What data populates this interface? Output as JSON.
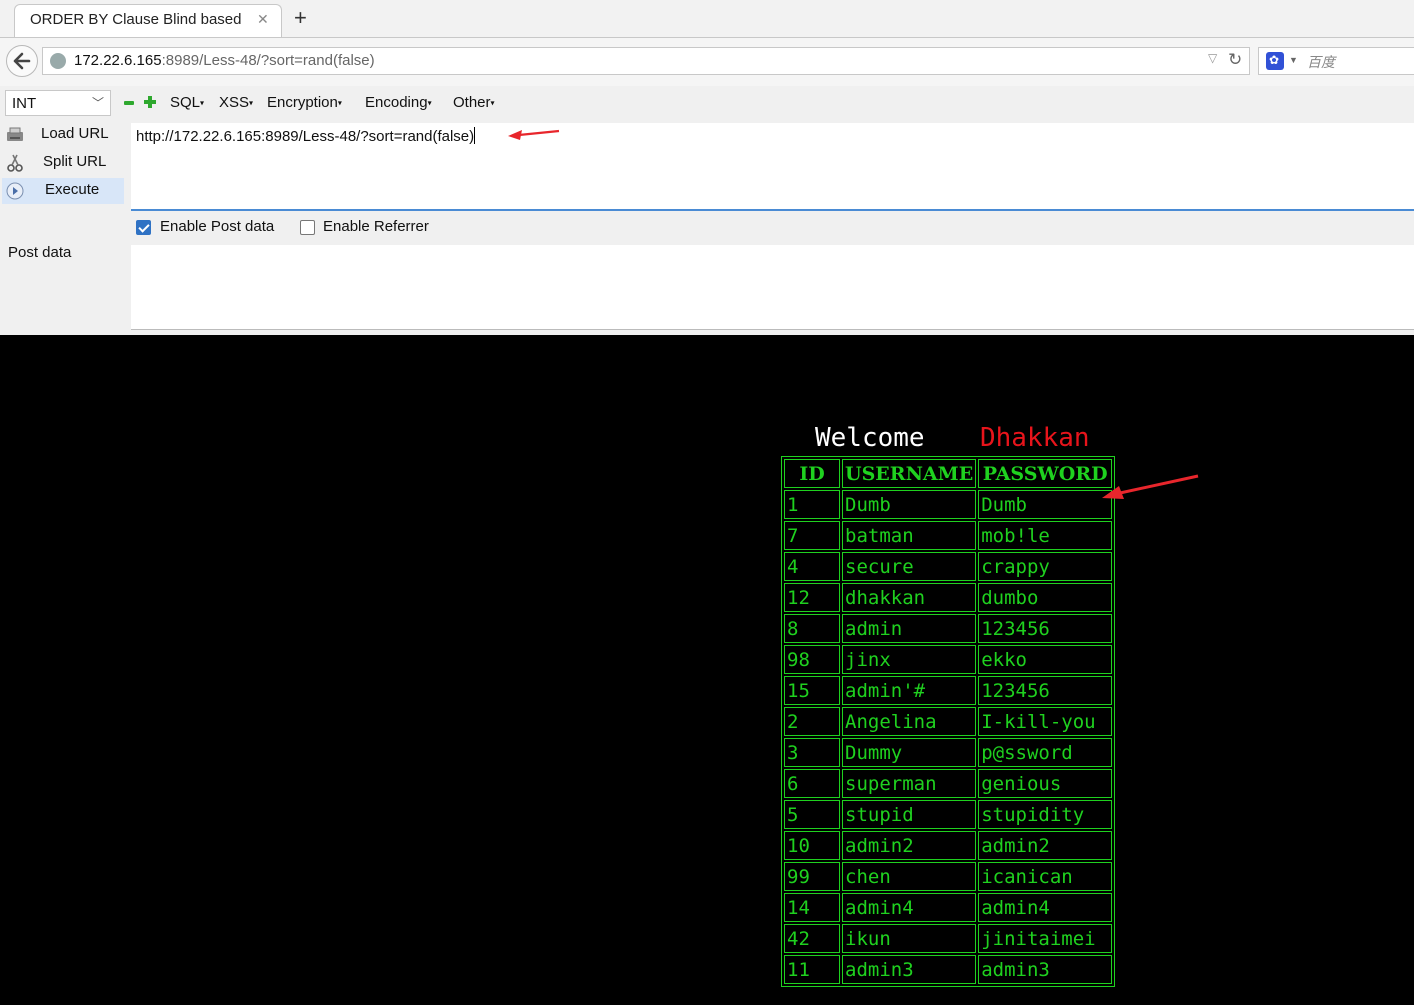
{
  "tab": {
    "title": "ORDER BY Clause Blind based"
  },
  "address_bar": {
    "host": "172.22.6.165",
    "rest": ":8989/Less-48/?sort=rand(false)"
  },
  "search_bar": {
    "placeholder": "百度"
  },
  "hackbar": {
    "type_select": "INT",
    "menu": {
      "sql": "SQL",
      "xss": "XSS",
      "encryption": "Encryption",
      "encoding": "Encoding",
      "other": "Other"
    },
    "actions": {
      "load": "Load URL",
      "split": "Split URL",
      "execute": "Execute"
    },
    "url_value": "http://172.22.6.165:8989/Less-48/?sort=rand(false)",
    "enable_post_label": "Enable Post data",
    "enable_post_checked": true,
    "enable_referrer_label": "Enable Referrer",
    "enable_referrer_checked": false,
    "post_data_label": "Post data"
  },
  "page": {
    "welcome": "Welcome",
    "name": "Dhakkan",
    "table": {
      "headers": [
        "ID",
        "USERNAME",
        "PASSWORD"
      ],
      "rows": [
        [
          "1",
          "Dumb",
          "Dumb"
        ],
        [
          "7",
          "batman",
          "mob!le"
        ],
        [
          "4",
          "secure",
          "crappy"
        ],
        [
          "12",
          "dhakkan",
          "dumbo"
        ],
        [
          "8",
          "admin",
          "123456"
        ],
        [
          "98",
          "jinx",
          "ekko"
        ],
        [
          "15",
          "admin'#",
          "123456"
        ],
        [
          "2",
          "Angelina",
          "I-kill-you"
        ],
        [
          "3",
          "Dummy",
          "p@ssword"
        ],
        [
          "6",
          "superman",
          "genious"
        ],
        [
          "5",
          "stupid",
          "stupidity"
        ],
        [
          "10",
          "admin2",
          "admin2"
        ],
        [
          "99",
          "chen",
          "icanican"
        ],
        [
          "14",
          "admin4",
          "admin4"
        ],
        [
          "42",
          "ikun",
          "jinitaimei"
        ],
        [
          "11",
          "admin3",
          "admin3"
        ]
      ]
    }
  },
  "colors": {
    "table_green": "#1fd11f",
    "name_red": "#e8141b",
    "annotation_red": "#e8262c",
    "page_bg": "#000000"
  }
}
